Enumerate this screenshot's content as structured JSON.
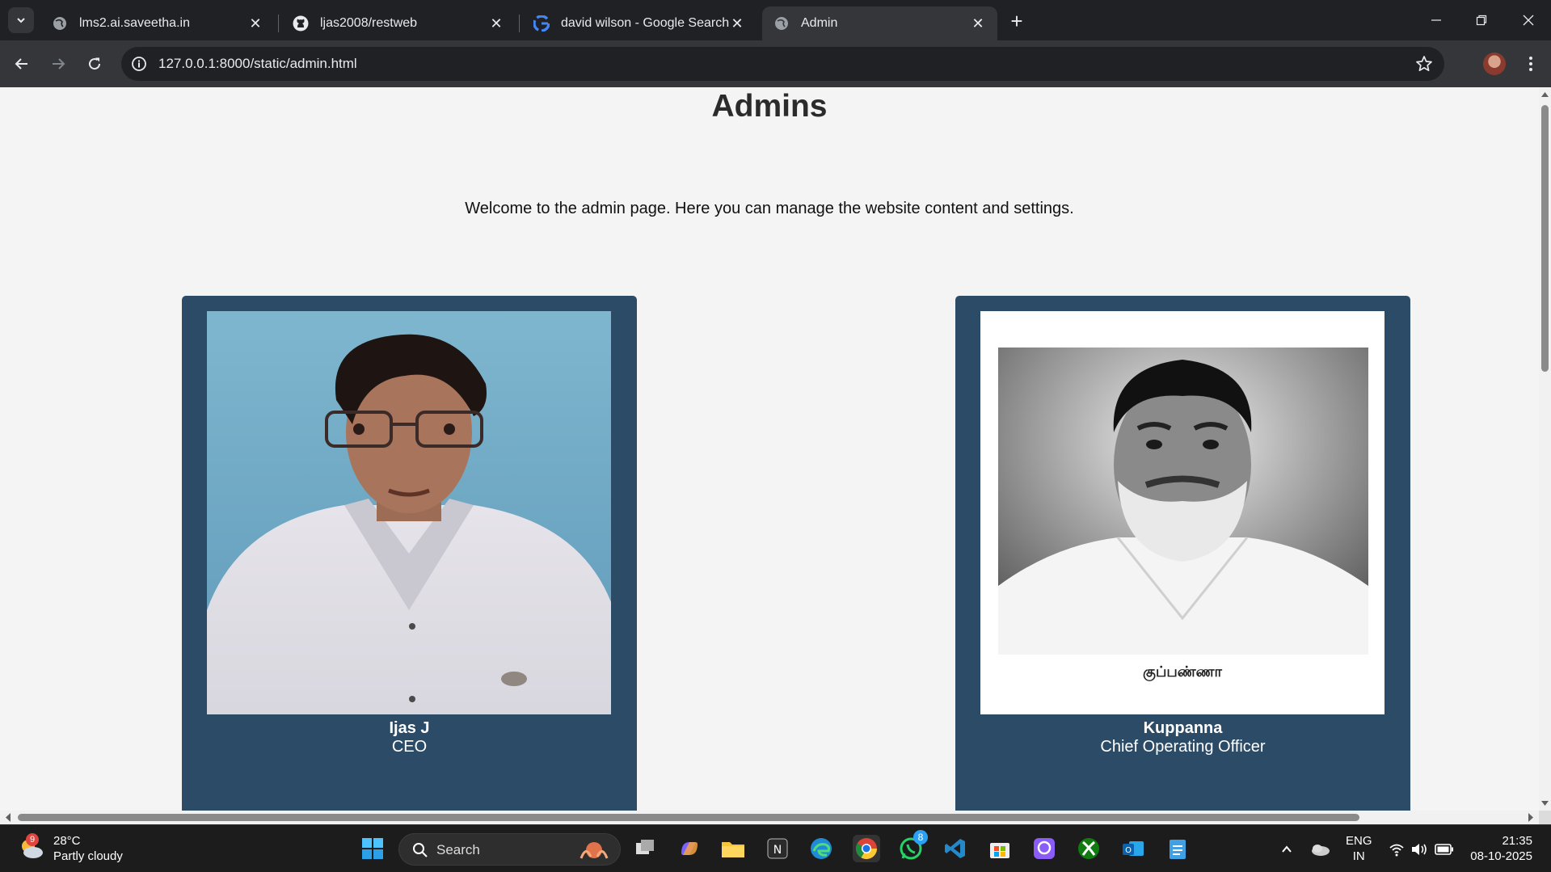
{
  "browser": {
    "tabs": [
      {
        "title": "lms2.ai.saveetha.in",
        "icon": "globe-icon",
        "active": false
      },
      {
        "title": "ljas2008/restweb",
        "icon": "github-icon",
        "active": false
      },
      {
        "title": "david wilson - Google Search",
        "icon": "google-icon",
        "active": false
      },
      {
        "title": "Admin",
        "icon": "globe-icon",
        "active": true
      }
    ],
    "url": "127.0.0.1:8000/static/admin.html"
  },
  "page": {
    "title": "Admins",
    "welcome": "Welcome to the admin page. Here you can manage the website content and settings.",
    "admins": [
      {
        "name": "Ijas J",
        "role": "CEO"
      },
      {
        "name": "Kuppanna",
        "role": "Chief Operating Officer",
        "caption": "குப்பண்ணா"
      }
    ]
  },
  "taskbar": {
    "weather": {
      "temp": "28°C",
      "condition": "Partly cloudy",
      "badge": "9"
    },
    "search_label": "Search",
    "whatsapp_badge": "8",
    "lang_top": "ENG",
    "lang_bottom": "IN",
    "time": "21:35",
    "date": "08-10-2025"
  },
  "colors": {
    "card": "#2c4b66",
    "page_bg": "#f4f4f4",
    "chrome_dark": "#202124",
    "chrome_toolbar": "#35363a"
  }
}
